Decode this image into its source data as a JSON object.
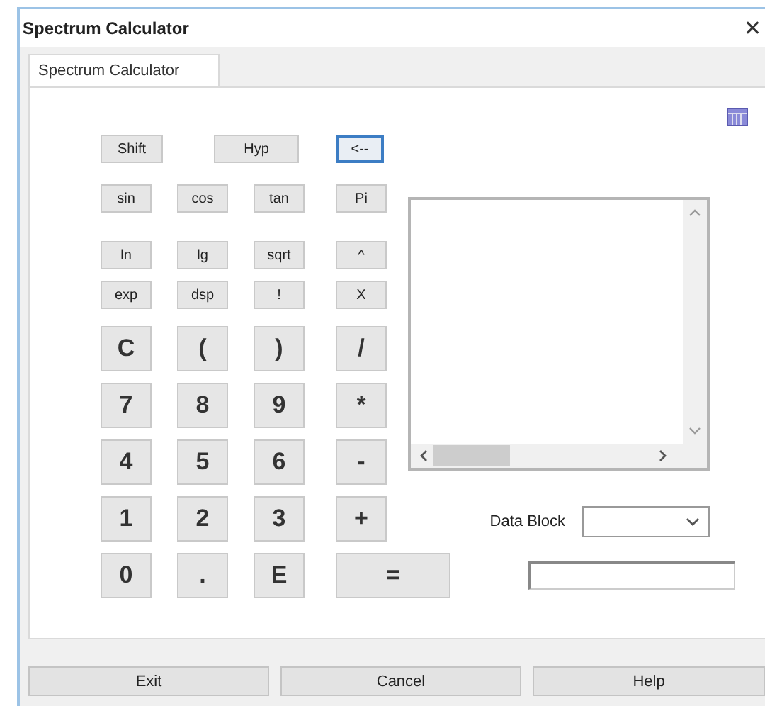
{
  "window": {
    "title": "Spectrum Calculator",
    "close": "✕"
  },
  "tabs": [
    {
      "label": "Spectrum Calculator",
      "selected": true
    }
  ],
  "modifier_keys": [
    {
      "label": "Shift",
      "focused": false
    },
    {
      "label": "Hyp",
      "focused": false
    },
    {
      "label": "<--",
      "focused": true
    }
  ],
  "function_keys": [
    [
      "sin",
      "cos",
      "tan",
      "Pi"
    ],
    [
      "ln",
      "lg",
      "sqrt",
      "^"
    ],
    [
      "exp",
      "dsp",
      "!",
      "X"
    ]
  ],
  "keypad": [
    [
      "C",
      "(",
      ")",
      "/"
    ],
    [
      "7",
      "8",
      "9",
      "*"
    ],
    [
      "4",
      "5",
      "6",
      "-"
    ],
    [
      "1",
      "2",
      "3",
      "+"
    ],
    [
      "0",
      ".",
      "E",
      "="
    ]
  ],
  "data_block": {
    "label": "Data Block"
  },
  "footer_buttons": [
    "Exit",
    "Cancel",
    "Help"
  ]
}
